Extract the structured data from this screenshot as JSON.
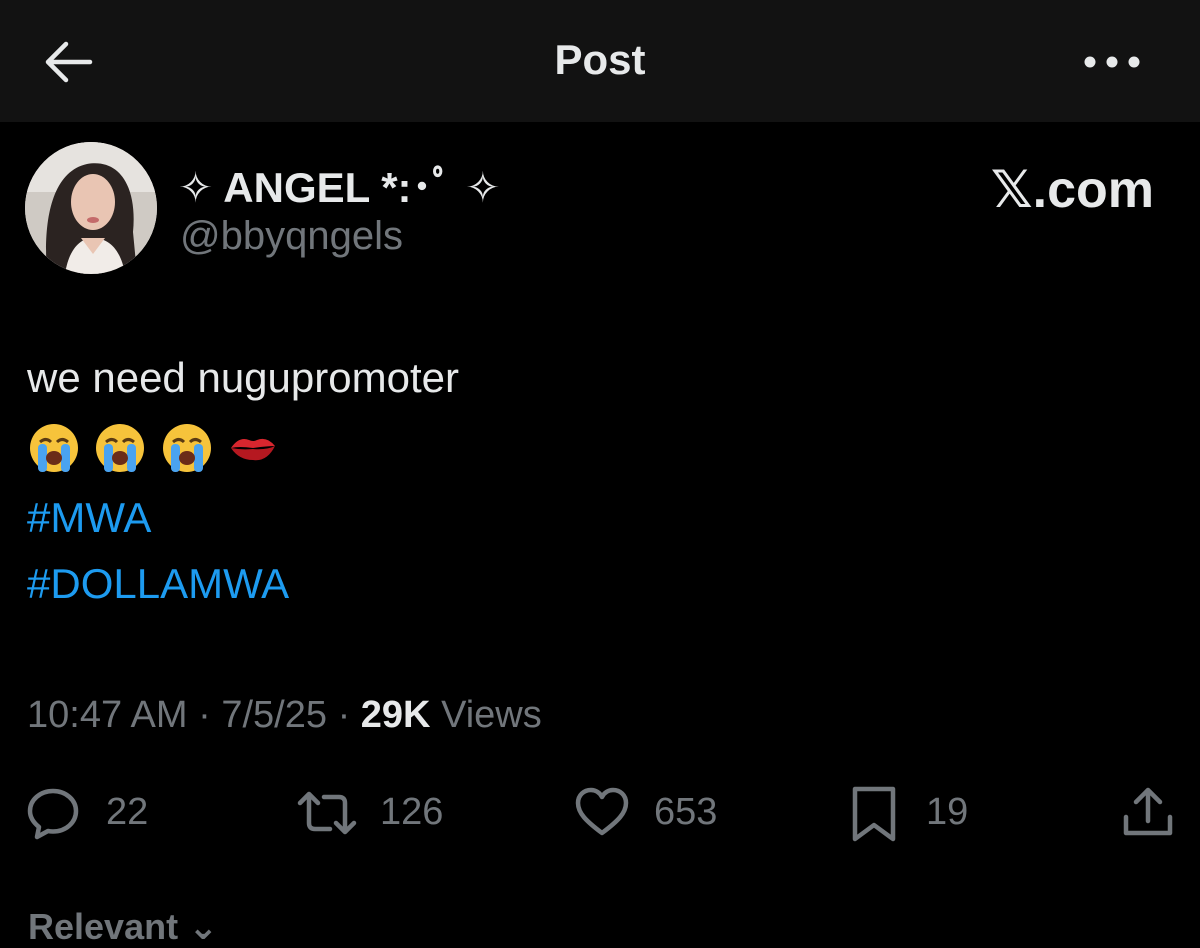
{
  "header": {
    "title": "Post",
    "back_icon": "arrow-left-icon",
    "more_icon": "more-horizontal-icon"
  },
  "author": {
    "display_name": "✧ ANGEL *:･ﾟ ✧",
    "handle": "@bbyqngels",
    "avatar_icon": "avatar"
  },
  "watermark": "𝕏.com",
  "post": {
    "text": "we need nugupromoter",
    "emojis": [
      "loudly-crying-face",
      "loudly-crying-face",
      "loudly-crying-face",
      "kiss-mark"
    ],
    "hashtags": [
      "#MWA",
      "#DOLLAMWA"
    ]
  },
  "meta": {
    "time": "10:47 AM",
    "separator": "·",
    "date": "7/5/25",
    "views_count": "29K",
    "views_label": "Views"
  },
  "actions": {
    "replies": "22",
    "reposts": "126",
    "likes": "653",
    "bookmarks": "19"
  },
  "footer": {
    "relevant_label": "Relevant"
  },
  "colors": {
    "background": "#000000",
    "topbar": "#121212",
    "text": "#e7e9ea",
    "secondary": "#71767b",
    "link": "#1d9bf0"
  }
}
